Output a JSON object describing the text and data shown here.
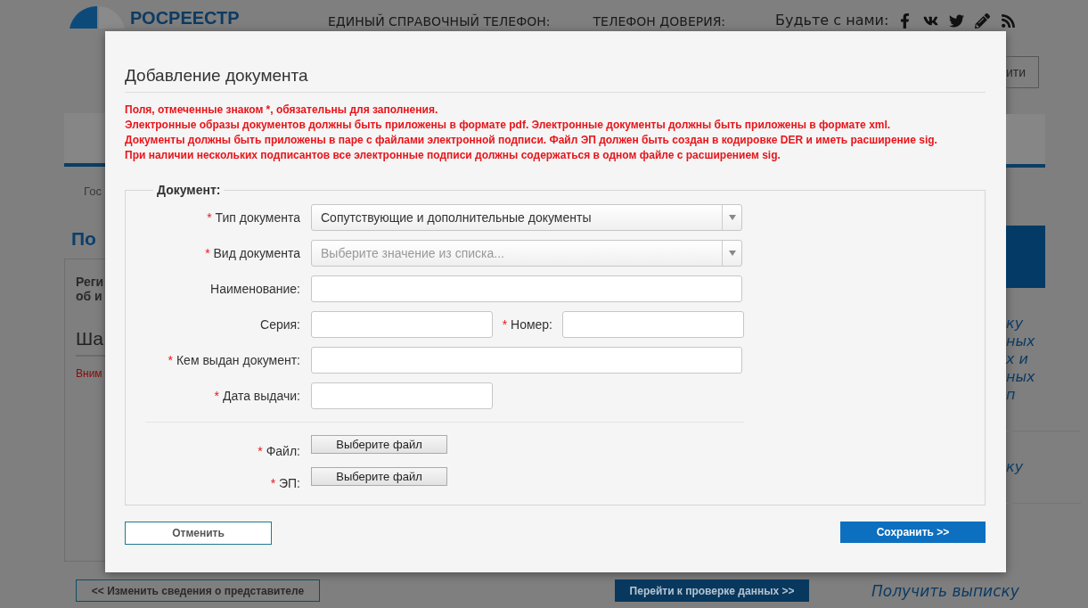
{
  "header": {
    "logo": "РОСРЕЕСТР",
    "phone_label": "ЕДИНЫЙ СПРАВОЧНЫЙ ТЕЛЕФОН:",
    "trust_label": "ТЕЛЕФОН ДОВЕРИЯ:",
    "social_label": "Будьте с нами:",
    "social": [
      {
        "kind": "facebook"
      },
      {
        "kind": "vk"
      },
      {
        "kind": "twitter"
      },
      {
        "kind": "pencil"
      },
      {
        "kind": "rss"
      }
    ],
    "button_fragment": "ити"
  },
  "left_fragments": {
    "breadcrumb": "Гос",
    "heading": "По",
    "subheading": [
      "Реги",
      "об и"
    ],
    "step": "Ша",
    "warning": "Вним"
  },
  "right_fragments": {
    "links": [
      [
        "ку",
        "ных",
        "х и",
        "ных",
        "п"
      ],
      [
        "ку"
      ]
    ]
  },
  "dialog": {
    "title": "Добавление документа",
    "notes": [
      "Поля, отмеченные знаком *, обязательны для заполнения.",
      "Электронные образы документов должны быть приложены в формате pdf. Электронные документы должны быть приложены в формате xml.",
      "Документы должны быть приложены в паре с файлами электронной подписи. Файл ЭП должен быть создан в кодировке DER и иметь расширение sig.",
      "При наличии нескольких подписантов все электронные подписи должны содержаться в одном файле с расширением sig."
    ],
    "legend": "Документ:",
    "fields": [
      {
        "kind": "select",
        "mark": "*",
        "label": "Тип документа",
        "value": "Сопутствующие и дополнительные документы"
      },
      {
        "kind": "select",
        "mark": "*",
        "label": "Вид документа",
        "placeholder": "Выберите значение из списка..."
      },
      {
        "kind": "text",
        "label": "Наименование:"
      },
      {
        "kind": "pair",
        "label": "Серия:",
        "second_mark": "*",
        "second_label": "Номер:"
      },
      {
        "kind": "text",
        "mark": "*",
        "label": "Кем выдан документ:"
      },
      {
        "kind": "short",
        "mark": "*",
        "label": "Дата выдачи:"
      }
    ],
    "files": [
      {
        "mark": "*",
        "label": "Файл:",
        "button": "Выберите файл"
      },
      {
        "mark": "*",
        "label": "ЭП:",
        "button": "Выберите файл"
      }
    ],
    "cancel": "Отменить",
    "save": "Сохранить >>"
  },
  "bottom": {
    "back_button": "<< Изменить сведения о представителе",
    "next_button": "Перейти к проверке данных >>",
    "extract_link": "Получить выписку"
  }
}
